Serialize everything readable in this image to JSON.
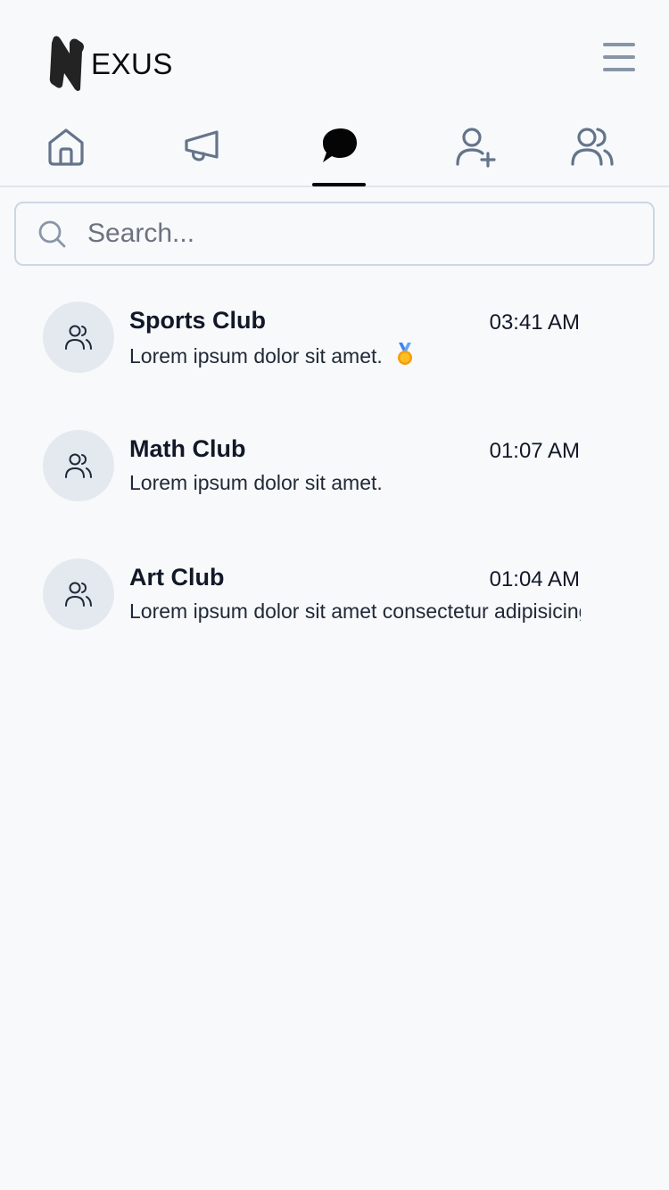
{
  "brand": {
    "name": "EXUS",
    "mark_color": "#232323"
  },
  "header": {
    "menu_icon": "hamburger-menu-icon"
  },
  "tabs": [
    {
      "id": "home",
      "icon": "home-icon",
      "active": false
    },
    {
      "id": "announcements",
      "icon": "megaphone-icon",
      "active": false
    },
    {
      "id": "chats",
      "icon": "chat-bubble-icon",
      "active": true
    },
    {
      "id": "add-user",
      "icon": "user-plus-icon",
      "active": false
    },
    {
      "id": "groups",
      "icon": "users-icon",
      "active": false
    }
  ],
  "search": {
    "placeholder": "Search...",
    "value": ""
  },
  "chats": [
    {
      "name": "Sports Club",
      "time": "03:41 AM",
      "message": "Lorem ipsum dolor sit amet.",
      "emoji": "medal-icon"
    },
    {
      "name": "Math Club",
      "time": "01:07 AM",
      "message": "Lorem ipsum dolor sit amet."
    },
    {
      "name": "Art Club",
      "time": "01:04 AM",
      "message": "Lorem ipsum dolor sit amet consectetur adipisicing elit."
    }
  ],
  "colors": {
    "background": "#f8f9fb",
    "icon_gray": "#64748b",
    "avatar_bg": "#e4e9f0",
    "search_border": "#cdd6e3",
    "active_indicator": "#050505"
  }
}
